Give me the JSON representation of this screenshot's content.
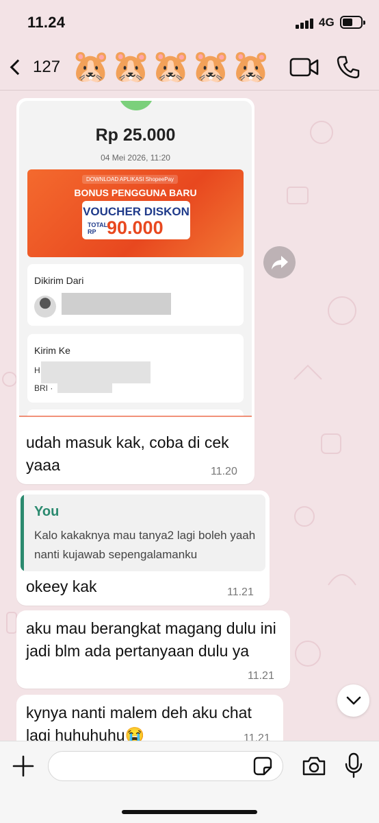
{
  "status_bar": {
    "time": "11.24",
    "network": "4G",
    "battery_level": 0.5
  },
  "header": {
    "back_count": "127",
    "contact_name_emojis": [
      "🐹",
      "🐹",
      "🐹",
      "🐹",
      "🐹"
    ],
    "icons": {
      "back": "chevron-left-icon",
      "video": "video-call-icon",
      "call": "phone-icon"
    }
  },
  "receipt": {
    "amount": "Rp 25.000",
    "date": "04 Mei 2026, 11:20",
    "promo": {
      "download_label": "DOWNLOAD APLIKASI ShopeePay",
      "bonus_title": "BONUS PENGGUNA BARU",
      "voucher_title": "VOUCHER DISKON",
      "total_label": "TOTAL RP",
      "amount": "90.000"
    },
    "sender_label": "Dikirim Dari",
    "recipient_label": "Kirim Ke",
    "recipient_initial": "H",
    "bank_label": "BRI ·"
  },
  "messages": [
    {
      "id": "m1",
      "text": "udah masuk kak, coba di cek yaaa",
      "time": "11.20"
    },
    {
      "id": "m2",
      "reply_to": {
        "author": "You",
        "text": "Kalo kakaknya mau tanya2 lagi boleh yaah nanti kujawab sepengalamanku"
      },
      "text": "okeey kak",
      "time": "11.21"
    },
    {
      "id": "m3",
      "text": "aku mau berangkat magang dulu ini jadi blm ada pertanyaan dulu ya",
      "time": "11.21"
    },
    {
      "id": "m4",
      "text": "kynya nanti malem deh aku chat lagi huhuhuhu😭",
      "time": "11.21"
    }
  ],
  "input": {
    "placeholder": "",
    "value": ""
  },
  "colors": {
    "chat_background": "#f3e3e6",
    "quote_accent": "#2b8a6f",
    "promo_orange": "#e8481f"
  }
}
